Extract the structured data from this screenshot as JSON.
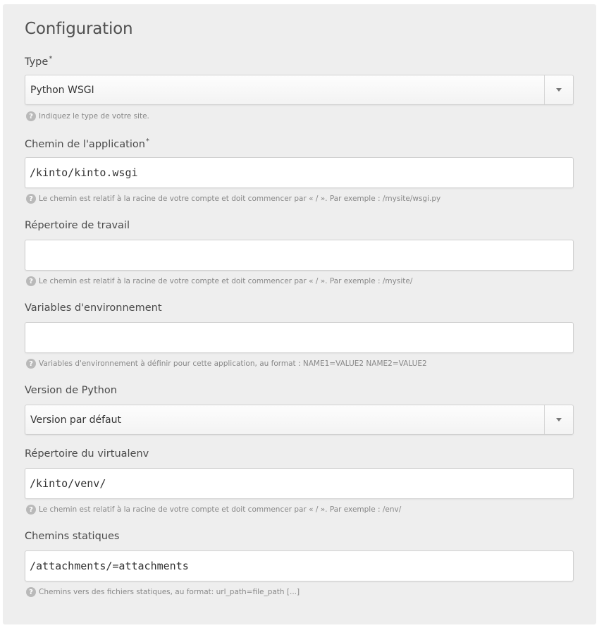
{
  "title": "Configuration",
  "required_marker": "*",
  "help_icon_glyph": "?",
  "fields": {
    "type": {
      "label": "Type",
      "value": "Python WSGI",
      "help": "Indiquez le type de votre site."
    },
    "app_path": {
      "label": "Chemin de l'application",
      "value": "/kinto/kinto.wsgi",
      "help": "Le chemin est relatif à la racine de votre compte et doit commencer par « / ». Par exemple : /mysite/wsgi.py"
    },
    "workdir": {
      "label": "Répertoire de travail",
      "value": "",
      "help": "Le chemin est relatif à la racine de votre compte et doit commencer par « / ». Par exemple : /mysite/"
    },
    "env_vars": {
      "label": "Variables d'environnement",
      "value": "",
      "help": "Variables d'environnement à définir pour cette application, au format : NAME1=VALUE2 NAME2=VALUE2"
    },
    "python_version": {
      "label": "Version de Python",
      "value": "Version par défaut"
    },
    "virtualenv": {
      "label": "Répertoire du virtualenv",
      "value": "/kinto/venv/",
      "help": "Le chemin est relatif à la racine de votre compte et doit commencer par « / ». Par exemple : /env/"
    },
    "static_paths": {
      "label": "Chemins statiques",
      "value": "/attachments/=attachments",
      "help": "Chemins vers des fichiers statiques, au format: url_path=file_path [...]"
    }
  }
}
